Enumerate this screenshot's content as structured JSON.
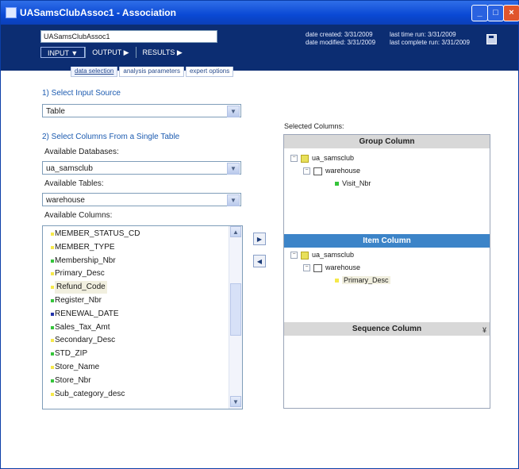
{
  "window": {
    "title": "UASamsClubAssoc1 - Association",
    "minimize": "_",
    "maximize": "□",
    "close": "×"
  },
  "header": {
    "name_value": "UASamsClubAssoc1",
    "meta": {
      "created": "date created: 3/31/2009",
      "modified": "date modified: 3/31/2009",
      "last_run": "last time run: 3/31/2009",
      "last_complete": "last complete run: 3/31/2009"
    }
  },
  "menu": {
    "input": "INPUT ▼",
    "output": "OUTPUT ▶",
    "results": "RESULTS ▶"
  },
  "subtabs": [
    "data selection",
    "analysis parameters",
    "expert options"
  ],
  "form": {
    "section1": "1) Select Input Source",
    "input_source": "Table",
    "section2": "2) Select Columns From a Single Table",
    "available_databases_label": "Available Databases:",
    "database": "ua_samsclub",
    "available_tables_label": "Available Tables:",
    "table": "warehouse",
    "available_columns_label": "Available Columns:",
    "columns": [
      {
        "name": "MEMBER_STATUS_CD",
        "color": "#f5e84a"
      },
      {
        "name": "MEMBER_TYPE",
        "color": "#f5e84a"
      },
      {
        "name": "Membership_Nbr",
        "color": "#35c43a"
      },
      {
        "name": "Primary_Desc",
        "color": "#f5e84a"
      },
      {
        "name": "Refund_Code",
        "color": "#f5e84a",
        "selected": true
      },
      {
        "name": "Register_Nbr",
        "color": "#35c43a"
      },
      {
        "name": "RENEWAL_DATE",
        "color": "#2233aa"
      },
      {
        "name": "Sales_Tax_Amt",
        "color": "#35c43a"
      },
      {
        "name": "Secondary_Desc",
        "color": "#f5e84a"
      },
      {
        "name": "STD_ZIP",
        "color": "#35c43a"
      },
      {
        "name": "Store_Name",
        "color": "#f5e84a"
      },
      {
        "name": "Store_Nbr",
        "color": "#35c43a"
      },
      {
        "name": "Sub_category_desc",
        "color": "#f5e84a"
      }
    ],
    "move_right": "▶",
    "move_left": "◀"
  },
  "selected": {
    "label": "Selected Columns:",
    "group_header": "Group Column",
    "item_header": "Item Column",
    "sequence_header": "Sequence Column",
    "group_tree": {
      "db": "ua_samsclub",
      "table": "warehouse",
      "column": "Visit_Nbr",
      "column_color": "#35c43a"
    },
    "item_tree": {
      "db": "ua_samsclub",
      "table": "warehouse",
      "column": "Primary_Desc",
      "column_color": "#f5e84a"
    },
    "collapse": "¥",
    "toggle_open": "−"
  }
}
